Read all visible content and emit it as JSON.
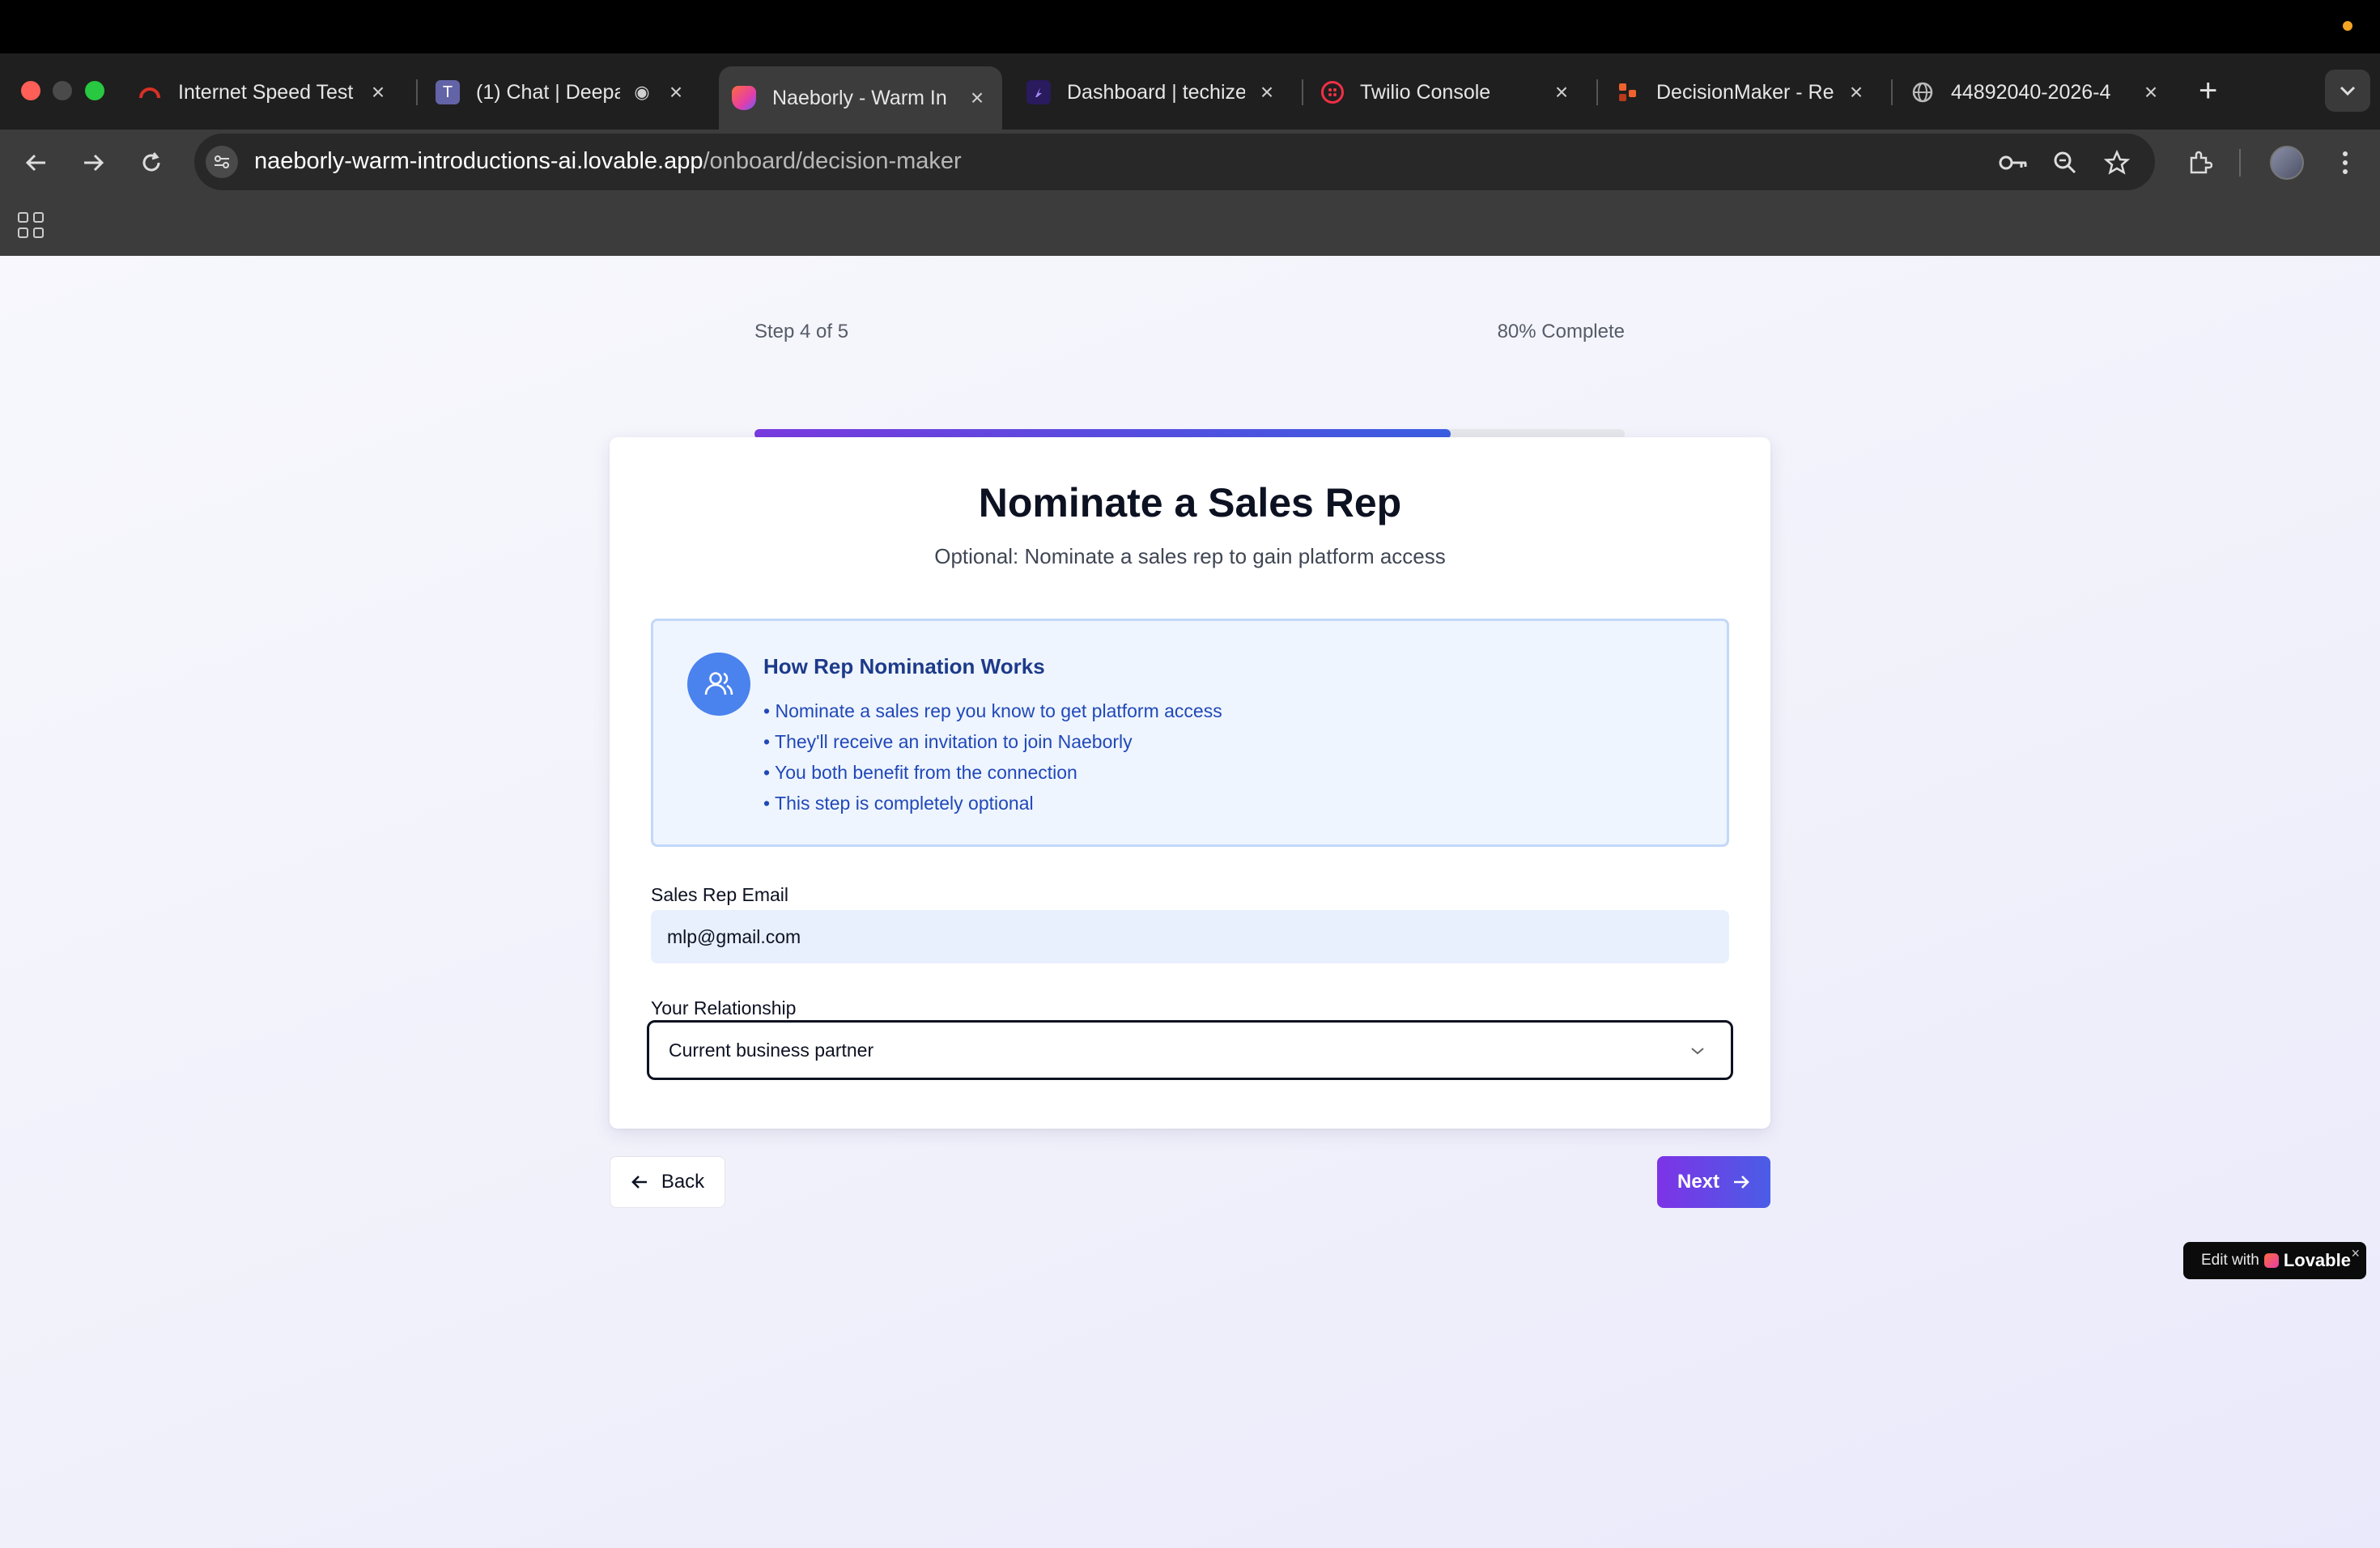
{
  "browser": {
    "tabs": [
      {
        "title": "Internet Speed Test",
        "favicon": "speedometer-icon",
        "color": "#d93025",
        "active": false
      },
      {
        "title": "(1) Chat | Deepa",
        "favicon": "teams-icon",
        "color": "#6264a7",
        "active": false
      },
      {
        "title": "Naeborly - Warm In",
        "favicon": "lovable-heart-icon",
        "color": "#ff5a7a",
        "active": true
      },
      {
        "title": "Dashboard | techize",
        "favicon": "dashboard-icon",
        "color": "#2a1a5e",
        "active": false
      },
      {
        "title": "Twilio Console",
        "favicon": "twilio-icon",
        "color": "#f22f46",
        "active": false
      },
      {
        "title": "DecisionMaker - Re",
        "favicon": "decisionmaker-icon",
        "color": "#f0622d",
        "active": false
      },
      {
        "title": "44892040-2026-4",
        "favicon": "globe-icon",
        "color": "#9a9a9a",
        "active": false
      }
    ],
    "url_host": "naeborly-warm-introductions-ai.lovable.app",
    "url_path": "/onboard/decision-maker"
  },
  "progress": {
    "step_label": "Step 4 of 5",
    "complete_label": "80% Complete",
    "fraction": 0.8
  },
  "card": {
    "title": "Nominate a Sales Rep",
    "subtitle": "Optional: Nominate a sales rep to gain platform access",
    "info": {
      "title": "How Rep Nomination Works",
      "items": [
        "Nominate a sales rep you know to get platform access",
        "They'll receive an invitation to join Naeborly",
        "You both benefit from the connection",
        "This step is completely optional"
      ]
    },
    "email_label": "Sales Rep Email",
    "email_value": "mlp@gmail.com",
    "relationship_label": "Your Relationship",
    "relationship_value": "Current business partner"
  },
  "nav": {
    "back_label": "Back",
    "next_label": "Next"
  },
  "badge": {
    "prefix": "Edit with",
    "brand": "Lovable",
    "close": "×"
  }
}
